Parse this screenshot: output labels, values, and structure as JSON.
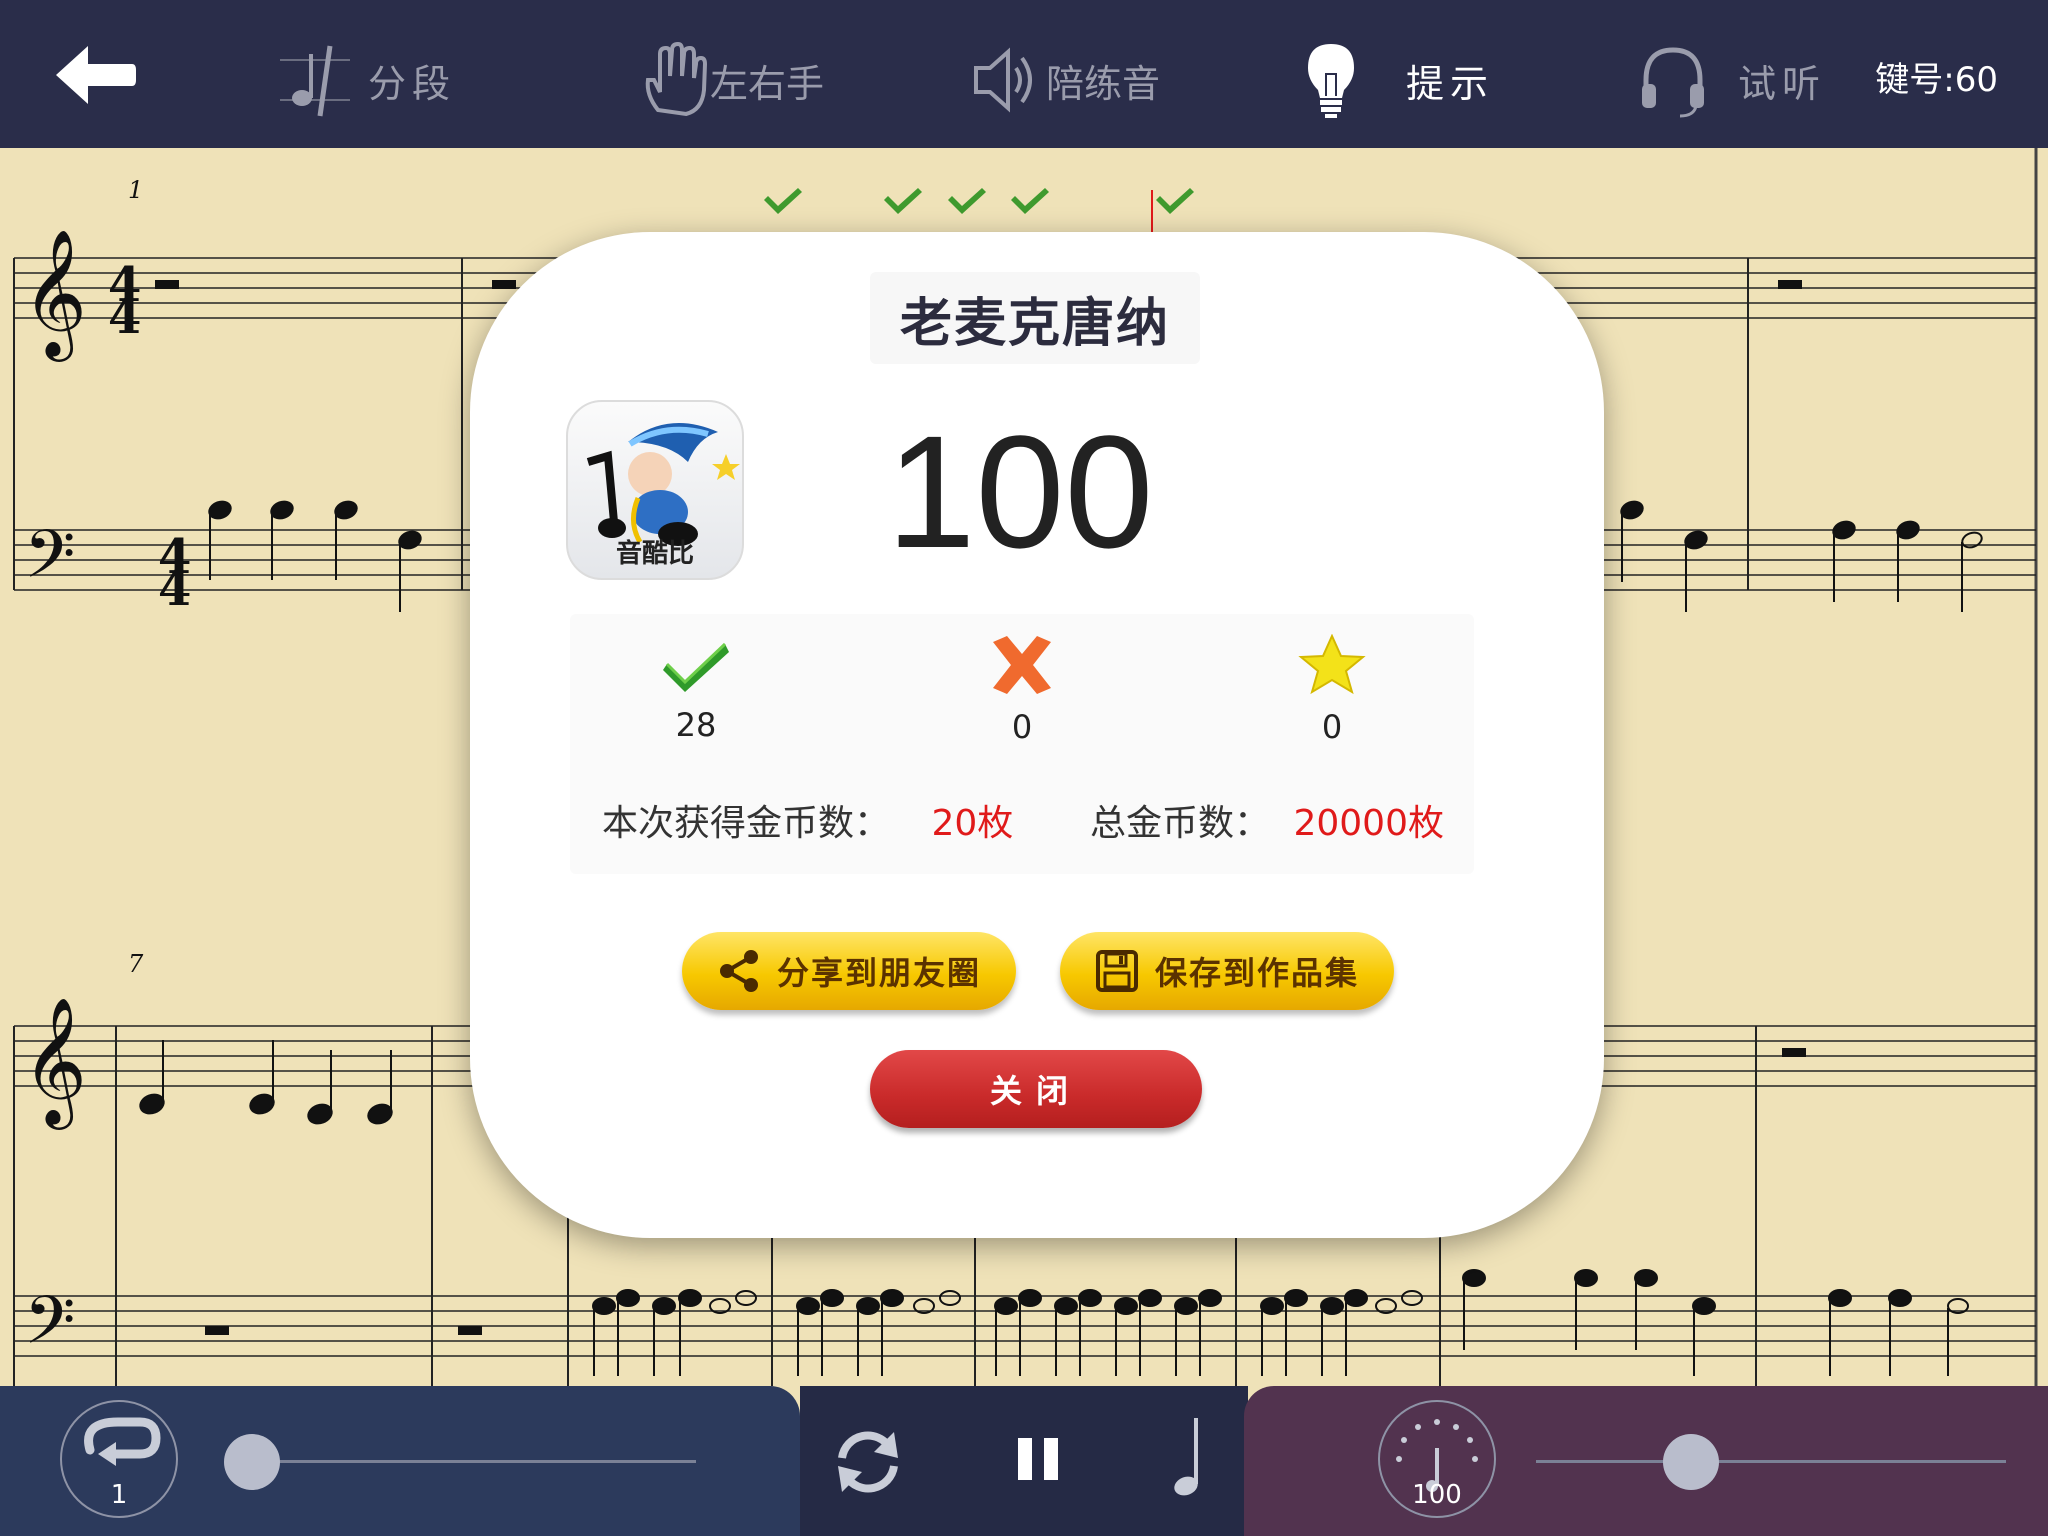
{
  "toolbar": {
    "back_icon": "back-arrow-icon",
    "items": [
      {
        "label": "分段",
        "icon": "segment-note-icon",
        "active": false
      },
      {
        "label": "左右手",
        "icon": "hand-icon",
        "active": false
      },
      {
        "label": "陪练音",
        "icon": "speaker-icon",
        "active": false
      },
      {
        "label": "提示",
        "icon": "lightbulb-icon",
        "active": true
      },
      {
        "label": "试听",
        "icon": "headphones-icon",
        "active": false
      }
    ],
    "key_number": "键号:60"
  },
  "sheet": {
    "measure_numbers": [
      "1",
      "7"
    ],
    "time_signature": "4/4"
  },
  "dialog": {
    "song_title": "老麦克唐纳",
    "app_logo_text": "音酷比",
    "score": "100",
    "stats": {
      "correct": "28",
      "wrong": "0",
      "stars": "0"
    },
    "coins_earned_label": "本次获得金币数：",
    "coins_earned_value": "20枚",
    "coins_total_label": "总金币数：",
    "coins_total_value": "20000枚",
    "share_button": "分享到朋友圈",
    "save_button": "保存到作品集",
    "close_button": "关闭"
  },
  "bottom": {
    "loop_count": "1",
    "tempo": "100",
    "loop_slider_value": 0.0,
    "tempo_slider_value": 0.33
  },
  "colors": {
    "toolbar_bg": "#2a2d4a",
    "paper": "#efe2b8",
    "accent_red": "#e01a1a",
    "button_yellow": "#f7c800",
    "close_red": "#c92a2a"
  }
}
